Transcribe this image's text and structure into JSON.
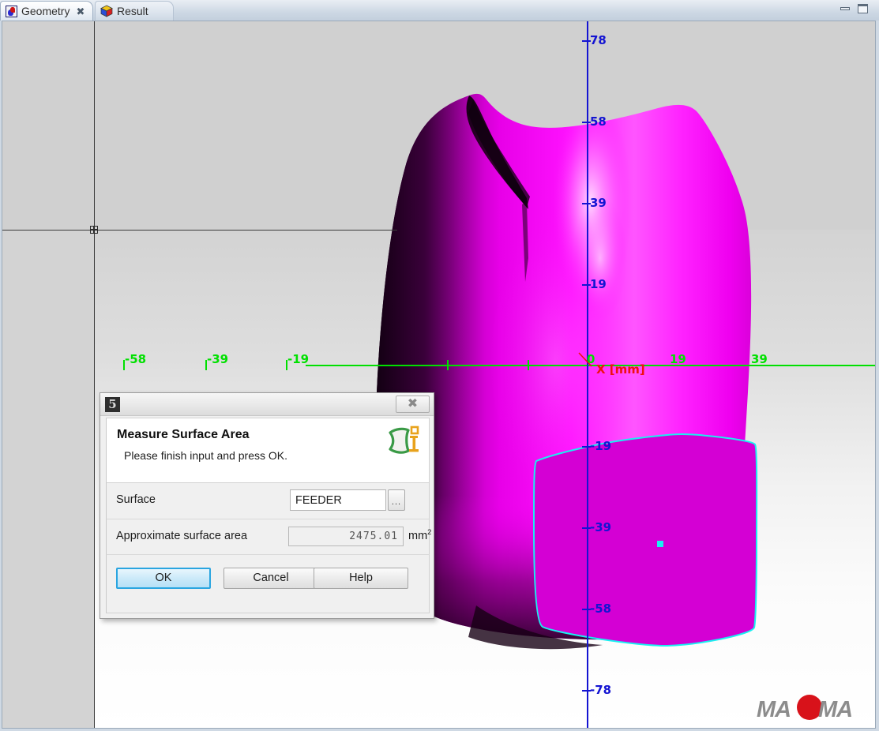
{
  "window": {
    "minimize_icon": "minimize-icon",
    "maximize_icon": "maximize-icon"
  },
  "tabs": [
    {
      "label": "Geometry",
      "icon": "geometry-icon",
      "close_glyph": "✖",
      "active": true
    },
    {
      "label": "Result",
      "icon": "cube-icon",
      "active": false
    }
  ],
  "viewport": {
    "branding": "MAGMA",
    "branding_parts": {
      "left": "MA",
      "accent": "G",
      "right": "MA"
    },
    "axes": {
      "x_title": "X [mm]",
      "x_color": "#00e000",
      "y_color": "#1414d2",
      "x_title_color": "#ef1010",
      "x_ticks": [
        "-58",
        "-39",
        "-19",
        "0",
        "19",
        "39"
      ],
      "y_ticks": [
        "78",
        "58",
        "39",
        "19",
        "-19",
        "-39",
        "-58",
        "-78"
      ]
    },
    "model": {
      "surface_color": "#ee00ee",
      "selection_outline_color": "#19f0f0",
      "selected_surface_color": "#d400d4"
    }
  },
  "dialog": {
    "app_icon_glyph": "5",
    "close_glyph": "✖",
    "title": "Measure Surface Area",
    "subtitle": "Please finish input and press OK.",
    "header_icon": "measure-surface-icon",
    "fields": {
      "surface_label": "Surface",
      "surface_value": "FEEDER",
      "surface_browse_label": "...",
      "area_label": "Approximate surface area",
      "area_value": "2475.01",
      "area_unit": "mm",
      "area_unit_exponent": "2"
    },
    "buttons": {
      "ok": "OK",
      "cancel": "Cancel",
      "help": "Help"
    }
  }
}
